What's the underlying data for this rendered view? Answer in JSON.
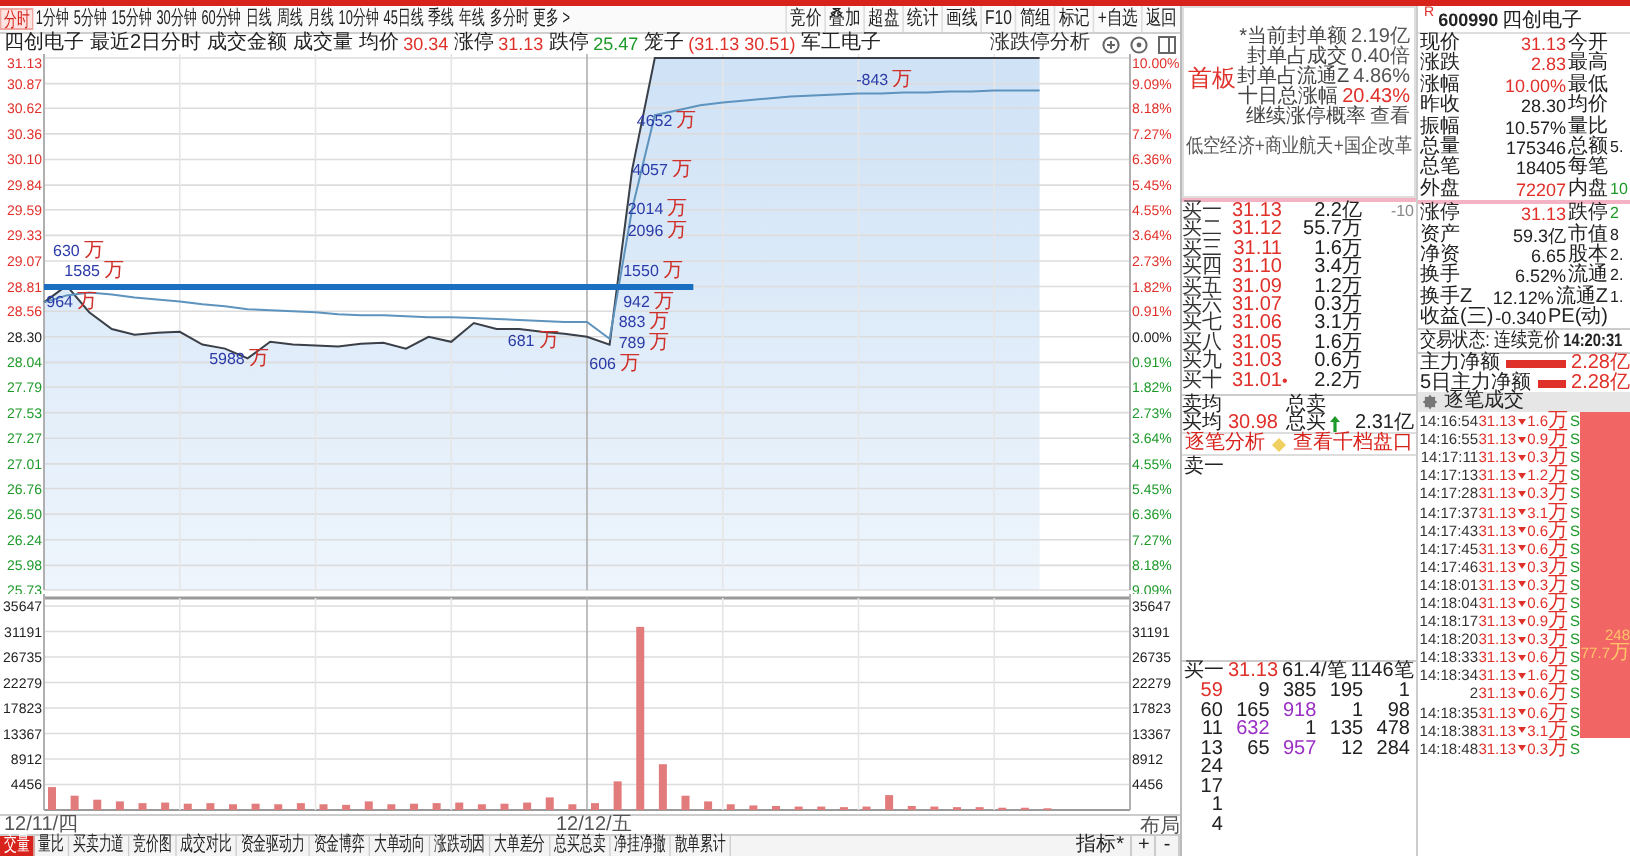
{
  "toolbar": {
    "periods": [
      {
        "label": "分时",
        "selected": true
      },
      {
        "label": "1分钟",
        "selected": false
      },
      {
        "label": "5分钟",
        "selected": false
      },
      {
        "label": "15分钟",
        "selected": false
      },
      {
        "label": "30分钟",
        "selected": false
      },
      {
        "label": "60分钟",
        "selected": false
      },
      {
        "label": "日线",
        "selected": false
      },
      {
        "label": "周线",
        "selected": false
      },
      {
        "label": "月线",
        "selected": false
      },
      {
        "label": "10分钟",
        "selected": false
      },
      {
        "label": "45日线",
        "selected": false
      },
      {
        "label": "季线",
        "selected": false
      },
      {
        "label": "年线",
        "selected": false
      },
      {
        "label": "多分时",
        "selected": false
      },
      {
        "label": "更多 >",
        "selected": false
      }
    ],
    "tools": [
      "竞价",
      "叠加",
      "超盘",
      "统计",
      "画线",
      "F10",
      "简组",
      "标记",
      "+自选",
      "返回"
    ]
  },
  "chart": {
    "stock": "四创电子",
    "info": [
      {
        "label": "最近2日分时"
      },
      {
        "label": "成交金额"
      },
      {
        "label": "成交量"
      },
      {
        "label": "均价",
        "value": "30.34",
        "color": "#e0302a"
      },
      {
        "label": "涨停",
        "value": "31.13",
        "color": "#e0302a"
      },
      {
        "label": "跌停",
        "value": "25.47",
        "color": "#1e9a2a"
      },
      {
        "label": "笼子",
        "value": "(31.13 30.51)",
        "color": "#e0302a"
      },
      {
        "label": "军工电子"
      }
    ],
    "analysis_button": "涨跌停分析",
    "price_panel": {
      "chart_data": {
        "type": "line",
        "ylim": [
          25.73,
          31.13
        ],
        "categories": [
          null,
          null,
          null,
          null,
          null,
          null,
          null,
          null,
          null,
          null,
          null,
          null,
          null,
          null,
          null,
          null,
          null,
          null,
          null,
          null,
          null,
          null,
          null,
          null,
          null,
          null,
          null,
          null,
          null,
          null,
          null,
          null,
          null,
          null,
          null,
          null,
          null,
          null,
          null,
          null,
          null,
          null,
          null,
          null,
          null
        ],
        "series": [
          {
            "color": "#3a3f48",
            "values": [
              28.65,
              28.82,
              28.55,
              28.38,
              28.32,
              28.34,
              28.35,
              28.22,
              28.18,
              28.08,
              28.25,
              28.22,
              28.21,
              28.2,
              28.23,
              28.24,
              28.18,
              28.3,
              28.25,
              28.44,
              28.38,
              28.38,
              28.35,
              28.33,
              28.3,
              28.22,
              30.0,
              31.13,
              31.13,
              31.13,
              31.13,
              31.13,
              31.13,
              31.13,
              31.13,
              31.13,
              31.13,
              31.13,
              31.13,
              31.13,
              31.13,
              31.13,
              31.13,
              31.13,
              31.13
            ]
          },
          {
            "color": "#5e93bd",
            "values": [
              28.65,
              28.72,
              28.75,
              28.73,
              28.7,
              28.68,
              28.66,
              28.63,
              28.61,
              28.58,
              28.57,
              28.56,
              28.55,
              28.53,
              28.52,
              28.52,
              28.51,
              28.5,
              28.5,
              28.49,
              28.48,
              28.47,
              28.46,
              28.45,
              28.45,
              28.28,
              29.6,
              30.55,
              30.6,
              30.65,
              30.68,
              30.7,
              30.72,
              30.74,
              30.75,
              30.76,
              30.77,
              30.77,
              30.78,
              30.78,
              30.79,
              30.79,
              30.8,
              30.8,
              30.8
            ]
          }
        ],
        "yticks": [
          {
            "value": 31.13,
            "label": "31.13"
          },
          {
            "value": 30.87,
            "label": "30.87"
          },
          {
            "value": 30.62,
            "label": "30.62"
          },
          {
            "value": 30.36,
            "label": "30.36"
          },
          {
            "value": 30.1,
            "label": "30.10"
          },
          {
            "value": 29.84,
            "label": "29.84"
          },
          {
            "value": 29.59,
            "label": "29.59"
          },
          {
            "value": 29.33,
            "label": "29.33"
          },
          {
            "value": 29.07,
            "label": "29.07"
          },
          {
            "value": 28.81,
            "label": "28.81"
          },
          {
            "value": 28.56,
            "label": "28.56"
          },
          {
            "value": 28.3,
            "label": "28.30"
          },
          {
            "value": 28.04,
            "label": "28.04"
          },
          {
            "value": 27.79,
            "label": "27.79"
          },
          {
            "value": 27.53,
            "label": "27.53"
          },
          {
            "value": 27.27,
            "label": "27.27"
          },
          {
            "value": 27.01,
            "label": "27.01"
          },
          {
            "value": 26.76,
            "label": "26.76"
          },
          {
            "value": 26.5,
            "label": "26.50"
          },
          {
            "value": 26.24,
            "label": "26.24"
          },
          {
            "value": 25.98,
            "label": "25.98"
          },
          {
            "value": 25.73,
            "label": "25.73"
          }
        ],
        "grid": true,
        "annotations": [
          {
            "text": "630 万"
          },
          {
            "text": "1585 万"
          },
          {
            "text": "964 万"
          },
          {
            "text": "5988 万"
          },
          {
            "text": "681 万"
          },
          {
            "text": "606 万"
          },
          {
            "text": "789 万"
          },
          {
            "text": "883 万"
          },
          {
            "text": "942 万"
          },
          {
            "text": "1550 万"
          },
          {
            "text": "2096 万"
          },
          {
            "text": "2014 万"
          },
          {
            "text": "4057 万"
          },
          {
            "text": "4652 万"
          },
          {
            "text": "-843 万"
          }
        ]
      },
      "percent_axis": [
        "10.00%",
        "9.09%",
        "8.18%",
        "7.27%",
        "6.36%",
        "5.45%",
        "4.55%",
        "3.64%",
        "2.73%",
        "1.82%",
        "0.91%",
        "0.00%",
        "0.91%",
        "1.82%",
        "2.73%",
        "3.64%",
        "4.55%",
        "5.45%",
        "6.36%",
        "7.27%",
        "8.18%",
        "9.09%"
      ]
    },
    "volume_panel": {
      "chart_data": {
        "type": "bar",
        "ylim": [
          0,
          35647
        ],
        "categories": [
          null,
          null,
          null,
          null,
          null,
          null,
          null,
          null,
          null,
          null,
          null,
          null,
          null,
          null,
          null,
          null,
          null,
          null,
          null,
          null,
          null,
          null,
          null,
          null,
          null,
          null,
          null,
          null,
          null,
          null,
          null,
          null,
          null,
          null,
          null,
          null,
          null,
          null,
          null,
          null,
          null,
          null,
          null,
          null,
          null
        ],
        "series": [
          {
            "color": "#e27b7b",
            "values": [
              4000,
              2500,
              1800,
              1500,
              1200,
              1300,
              1100,
              1200,
              1000,
              1100,
              1000,
              1200,
              1000,
              900,
              1500,
              1000,
              1100,
              1200,
              1300,
              1000,
              1100,
              1300,
              2200,
              1000,
              1200,
              5000,
              32000,
              8000,
              2500,
              1500,
              1000,
              800,
              700,
              600,
              600,
              500,
              600,
              2600,
              700,
              600,
              500,
              500,
              400,
              400,
              300
            ]
          }
        ],
        "yticks": [
          35647,
          31191,
          26735,
          22279,
          17823,
          13367,
          8912,
          4456
        ],
        "grid": true
      },
      "right_axis": [
        "35647",
        "31191",
        "26735",
        "22279",
        "17823",
        "13367",
        "8912",
        "4456"
      ]
    },
    "dates": [
      "12/11/四",
      "12/12/五"
    ],
    "layout_button": "布局",
    "bottom_tabs": [
      {
        "label": "交量",
        "selected": true
      },
      {
        "label": "量比",
        "selected": false
      },
      {
        "label": "买卖力道",
        "selected": false
      },
      {
        "label": "竞价图",
        "selected": false
      },
      {
        "label": "成交对比",
        "selected": false
      },
      {
        "label": "资金驱动力",
        "selected": false
      },
      {
        "label": "资金博弈",
        "selected": false
      },
      {
        "label": "大单动向",
        "selected": false
      },
      {
        "label": "涨跌动因",
        "selected": false
      },
      {
        "label": "大单差分",
        "selected": false
      },
      {
        "label": "总买总卖",
        "selected": false
      },
      {
        "label": "净挂净撤",
        "selected": false
      },
      {
        "label": "散单累计",
        "selected": false
      }
    ],
    "indicator_button": "指标*",
    "zoom_buttons": [
      "+",
      "-"
    ]
  },
  "right_panel": {
    "card": {
      "badge": "首板",
      "lines": [
        {
          "label": "*当前封单额",
          "value": "2.19亿"
        },
        {
          "label": "封单占成交",
          "value": "0.40倍"
        },
        {
          "label": "封单占流通Z",
          "value": "4.86%"
        },
        {
          "label": "十日总涨幅",
          "value": "20.43%",
          "color": "#e0302a"
        },
        {
          "label": "继续涨停概率",
          "value": "查看"
        }
      ],
      "concepts": "低空经济+商业航天+国企改革"
    },
    "bids": [
      {
        "label": "买一",
        "price": "31.13",
        "volume": "2.2亿",
        "change": "-10"
      },
      {
        "label": "买二",
        "price": "31.12",
        "volume": "55.7万"
      },
      {
        "label": "买三",
        "price": "31.11",
        "volume": "1.6万"
      },
      {
        "label": "买四",
        "price": "31.10",
        "volume": "3.4万"
      },
      {
        "label": "买五",
        "price": "31.09",
        "volume": "1.2万"
      },
      {
        "label": "买六",
        "price": "31.07",
        "volume": "0.3万"
      },
      {
        "label": "买七",
        "price": "31.06",
        "volume": "3.1万"
      },
      {
        "label": "买八",
        "price": "31.05",
        "volume": "1.6万"
      },
      {
        "label": "买九",
        "price": "31.03",
        "volume": "0.6万"
      },
      {
        "label": "买十",
        "price": "31.01",
        "flag": "•",
        "volume": "2.2万"
      }
    ],
    "sums": [
      {
        "label": "卖均",
        "total_label": "总卖"
      },
      {
        "label": "买均",
        "value": "30.98",
        "total_label": "总买",
        "total": "2.31亿"
      }
    ],
    "links": [
      "逐笔分析",
      "查看千档盘口"
    ],
    "sell_queue": "卖一",
    "queue": {
      "side": "买一",
      "price": "31.13",
      "per_order": "61.4/笔",
      "orders": "1146笔",
      "rows": [
        [
          {
            "text": "59",
            "color": "#e0302a"
          },
          {
            "text": "9"
          },
          {
            "text": "385"
          },
          {
            "text": "195"
          },
          {
            "text": "1"
          }
        ],
        [
          {
            "text": "60"
          },
          {
            "text": "165"
          },
          {
            "text": "918",
            "color": "#9b2fc4"
          },
          {
            "text": "1"
          },
          {
            "text": "98"
          }
        ],
        [
          {
            "text": "11"
          },
          {
            "text": "632",
            "color": "#9b2fc4"
          },
          {
            "text": "1"
          },
          {
            "text": "135"
          },
          {
            "text": "478"
          }
        ],
        [
          {
            "text": "13"
          },
          {
            "text": "65"
          },
          {
            "text": "957",
            "color": "#9b2fc4"
          },
          {
            "text": "12"
          },
          {
            "text": "284"
          }
        ],
        [
          {
            "text": "24"
          }
        ],
        [
          {
            "text": "17"
          }
        ],
        [
          {
            "text": "1"
          }
        ],
        [
          {
            "text": "4"
          }
        ]
      ]
    },
    "header": {
      "flag": "R",
      "code": "600990",
      "name": "四创电子"
    },
    "quote": [
      [
        {
          "label": "现价",
          "value": "31.13",
          "color": "#e0302a"
        },
        {
          "label": "今开"
        }
      ],
      [
        {
          "label": "涨跌",
          "value": "2.83",
          "color": "#e0302a"
        },
        {
          "label": "最高"
        }
      ],
      [
        {
          "label": "涨幅",
          "value": "10.00%",
          "color": "#e0302a"
        },
        {
          "label": "最低"
        }
      ],
      [
        {
          "label": "昨收",
          "value": "28.30"
        },
        {
          "label": "均价"
        }
      ],
      [
        {
          "label": "振幅",
          "value": "10.57%"
        },
        {
          "label": "量比"
        }
      ],
      [
        {
          "label": "总量",
          "value": "175346"
        },
        {
          "label": "总额",
          "value": "5."
        }
      ],
      [
        {
          "label": "总笔",
          "value": "18405"
        },
        {
          "label": "每笔"
        }
      ],
      [
        {
          "label": "外盘",
          "value": "72207",
          "color": "#e0302a"
        },
        {
          "label": "内盘",
          "value": "10",
          "color": "#1e9a2a"
        }
      ]
    ],
    "quote2": [
      [
        {
          "label": "涨停",
          "value": "31.13",
          "color": "#e0302a"
        },
        {
          "label": "跌停",
          "value": "2",
          "color": "#1e9a2a"
        }
      ],
      [
        {
          "label": "资产",
          "value": "59.3亿"
        },
        {
          "label": "市值",
          "value": "8"
        }
      ],
      [
        {
          "label": "净资",
          "value": "6.65"
        },
        {
          "label": "股本",
          "value": "2."
        }
      ],
      [
        {
          "label": "换手",
          "value": "6.52%"
        },
        {
          "label": "流通",
          "value": "2."
        }
      ],
      [
        {
          "label": "换手Z",
          "value": "12.12%"
        },
        {
          "label": "流通Z",
          "value": "1."
        }
      ],
      [
        {
          "label": "收益(三)",
          "value": "-0.340"
        },
        {
          "label": "PE(动)"
        }
      ]
    ],
    "status": {
      "label": "交易状态: 连续竞价",
      "time": "14:20:31"
    },
    "flows": [
      {
        "label": "主力净额",
        "value": "2.28亿",
        "level": 1
      },
      {
        "label": "5日主力净额",
        "value": "2.28亿",
        "level": 1
      }
    ],
    "ticks_title": "逐笔成交",
    "ticks": [
      {
        "time": "14:16:54",
        "price": "31.13",
        "volume": "1.6万",
        "side": "S"
      },
      {
        "time": "14:16:55",
        "price": "31.13",
        "volume": "0.9万",
        "side": "S"
      },
      {
        "time": "14:17:11",
        "price": "31.13",
        "volume": "0.3万",
        "side": "S"
      },
      {
        "time": "14:17:13",
        "price": "31.13",
        "volume": "1.2万",
        "side": "S"
      },
      {
        "time": "14:17:28",
        "price": "31.13",
        "volume": "0.3万",
        "side": "S"
      },
      {
        "time": "14:17:37",
        "price": "31.13",
        "volume": "3.1万",
        "side": "S"
      },
      {
        "time": "14:17:43",
        "price": "31.13",
        "volume": "0.6万",
        "side": "S"
      },
      {
        "time": "14:17:45",
        "price": "31.13",
        "volume": "0.6万",
        "side": "S"
      },
      {
        "time": "14:17:46",
        "price": "31.13",
        "volume": "0.3万",
        "side": "S"
      },
      {
        "time": "14:18:01",
        "price": "31.13",
        "volume": "0.3万",
        "side": "S"
      },
      {
        "time": "14:18:04",
        "price": "31.13",
        "volume": "0.6万",
        "side": "S"
      },
      {
        "time": "14:18:17",
        "price": "31.13",
        "volume": "0.9万",
        "side": "S"
      },
      {
        "time": "14:18:20",
        "price": "31.13",
        "volume": "0.3万",
        "side": "S"
      },
      {
        "time": "14:18:33",
        "price": "31.13",
        "volume": "0.6万",
        "side": "S"
      },
      {
        "time": "14:18:34",
        "price": "31.13",
        "volume": "1.6万",
        "side": "S"
      },
      {
        "time": "2",
        "price": "31.13",
        "volume": "0.6万",
        "side": "S"
      },
      {
        "time": "14:18:35",
        "price": "31.13",
        "volume": "0.6万",
        "side": "S"
      },
      {
        "time": "14:18:38",
        "price": "31.13",
        "volume": "3.1万",
        "side": "S"
      },
      {
        "time": "14:18:48",
        "price": "31.13",
        "volume": "0.3万",
        "side": "S"
      }
    ],
    "tick_bar_labels": [
      "248",
      "77.7万"
    ]
  }
}
